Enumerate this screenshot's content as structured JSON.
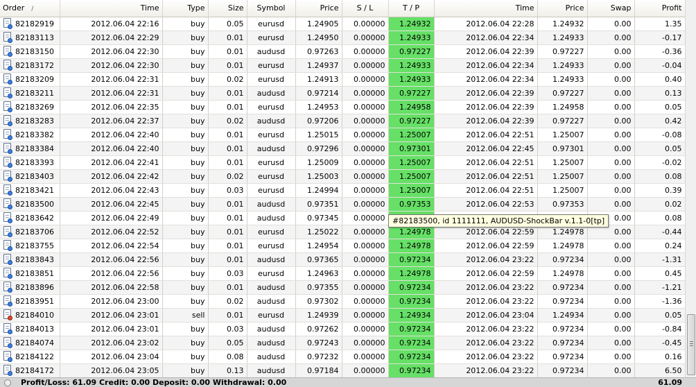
{
  "columns": [
    "Order",
    "Time",
    "Type",
    "Size",
    "Symbol",
    "Price",
    "S / L",
    "T / P",
    "Time",
    "Price",
    "Swap",
    "Profit"
  ],
  "sort_indicator": "/",
  "rows": [
    {
      "order": "82182919",
      "open_time": "2012.06.04 22:16",
      "type": "buy",
      "size": "0.05",
      "symbol": "eurusd",
      "price": "1.24905",
      "sl": "0.00000",
      "tp": "1.24932",
      "close_time": "2012.06.04 22:28",
      "close_price": "1.24932",
      "swap": "0.00",
      "profit": "1.35"
    },
    {
      "order": "82183113",
      "open_time": "2012.06.04 22:29",
      "type": "buy",
      "size": "0.01",
      "symbol": "eurusd",
      "price": "1.24950",
      "sl": "0.00000",
      "tp": "1.24933",
      "close_time": "2012.06.04 22:34",
      "close_price": "1.24933",
      "swap": "0.00",
      "profit": "-0.17"
    },
    {
      "order": "82183150",
      "open_time": "2012.06.04 22:30",
      "type": "buy",
      "size": "0.01",
      "symbol": "audusd",
      "price": "0.97263",
      "sl": "0.00000",
      "tp": "0.97227",
      "close_time": "2012.06.04 22:39",
      "close_price": "0.97227",
      "swap": "0.00",
      "profit": "-0.36"
    },
    {
      "order": "82183172",
      "open_time": "2012.06.04 22:30",
      "type": "buy",
      "size": "0.01",
      "symbol": "eurusd",
      "price": "1.24937",
      "sl": "0.00000",
      "tp": "1.24933",
      "close_time": "2012.06.04 22:34",
      "close_price": "1.24933",
      "swap": "0.00",
      "profit": "-0.04"
    },
    {
      "order": "82183209",
      "open_time": "2012.06.04 22:31",
      "type": "buy",
      "size": "0.02",
      "symbol": "eurusd",
      "price": "1.24913",
      "sl": "0.00000",
      "tp": "1.24933",
      "close_time": "2012.06.04 22:34",
      "close_price": "1.24933",
      "swap": "0.00",
      "profit": "0.40"
    },
    {
      "order": "82183211",
      "open_time": "2012.06.04 22:31",
      "type": "buy",
      "size": "0.01",
      "symbol": "audusd",
      "price": "0.97214",
      "sl": "0.00000",
      "tp": "0.97227",
      "close_time": "2012.06.04 22:39",
      "close_price": "0.97227",
      "swap": "0.00",
      "profit": "0.13"
    },
    {
      "order": "82183269",
      "open_time": "2012.06.04 22:35",
      "type": "buy",
      "size": "0.01",
      "symbol": "eurusd",
      "price": "1.24953",
      "sl": "0.00000",
      "tp": "1.24958",
      "close_time": "2012.06.04 22:39",
      "close_price": "1.24958",
      "swap": "0.00",
      "profit": "0.05"
    },
    {
      "order": "82183283",
      "open_time": "2012.06.04 22:37",
      "type": "buy",
      "size": "0.02",
      "symbol": "audusd",
      "price": "0.97206",
      "sl": "0.00000",
      "tp": "0.97227",
      "close_time": "2012.06.04 22:39",
      "close_price": "0.97227",
      "swap": "0.00",
      "profit": "0.42"
    },
    {
      "order": "82183382",
      "open_time": "2012.06.04 22:40",
      "type": "buy",
      "size": "0.01",
      "symbol": "eurusd",
      "price": "1.25015",
      "sl": "0.00000",
      "tp": "1.25007",
      "close_time": "2012.06.04 22:51",
      "close_price": "1.25007",
      "swap": "0.00",
      "profit": "-0.08"
    },
    {
      "order": "82183384",
      "open_time": "2012.06.04 22:40",
      "type": "buy",
      "size": "0.01",
      "symbol": "audusd",
      "price": "0.97296",
      "sl": "0.00000",
      "tp": "0.97301",
      "close_time": "2012.06.04 22:45",
      "close_price": "0.97301",
      "swap": "0.00",
      "profit": "0.05"
    },
    {
      "order": "82183393",
      "open_time": "2012.06.04 22:41",
      "type": "buy",
      "size": "0.01",
      "symbol": "eurusd",
      "price": "1.25009",
      "sl": "0.00000",
      "tp": "1.25007",
      "close_time": "2012.06.04 22:51",
      "close_price": "1.25007",
      "swap": "0.00",
      "profit": "-0.02"
    },
    {
      "order": "82183403",
      "open_time": "2012.06.04 22:42",
      "type": "buy",
      "size": "0.02",
      "symbol": "eurusd",
      "price": "1.25003",
      "sl": "0.00000",
      "tp": "1.25007",
      "close_time": "2012.06.04 22:51",
      "close_price": "1.25007",
      "swap": "0.00",
      "profit": "0.08"
    },
    {
      "order": "82183421",
      "open_time": "2012.06.04 22:43",
      "type": "buy",
      "size": "0.03",
      "symbol": "eurusd",
      "price": "1.24994",
      "sl": "0.00000",
      "tp": "1.25007",
      "close_time": "2012.06.04 22:51",
      "close_price": "1.25007",
      "swap": "0.00",
      "profit": "0.39"
    },
    {
      "order": "82183500",
      "open_time": "2012.06.04 22:45",
      "type": "buy",
      "size": "0.01",
      "symbol": "audusd",
      "price": "0.97351",
      "sl": "0.00000",
      "tp": "0.97353",
      "close_time": "2012.06.04 22:53",
      "close_price": "0.97353",
      "swap": "0.00",
      "profit": "0.02"
    },
    {
      "order": "82183642",
      "open_time": "2012.06.04 22:49",
      "type": "buy",
      "size": "0.01",
      "symbol": "audusd",
      "price": "0.97345",
      "sl": "0.00000",
      "tp": "",
      "close_time": "",
      "close_price": "",
      "swap": "0.00",
      "profit": "0.08"
    },
    {
      "order": "82183706",
      "open_time": "2012.06.04 22:52",
      "type": "buy",
      "size": "0.01",
      "symbol": "eurusd",
      "price": "1.25022",
      "sl": "0.00000",
      "tp": "1.24978",
      "close_time": "2012.06.04 22:59",
      "close_price": "1.24978",
      "swap": "0.00",
      "profit": "-0.44"
    },
    {
      "order": "82183755",
      "open_time": "2012.06.04 22:54",
      "type": "buy",
      "size": "0.01",
      "symbol": "eurusd",
      "price": "1.24954",
      "sl": "0.00000",
      "tp": "1.24978",
      "close_time": "2012.06.04 22:59",
      "close_price": "1.24978",
      "swap": "0.00",
      "profit": "0.24"
    },
    {
      "order": "82183843",
      "open_time": "2012.06.04 22:56",
      "type": "buy",
      "size": "0.01",
      "symbol": "audusd",
      "price": "0.97365",
      "sl": "0.00000",
      "tp": "0.97234",
      "close_time": "2012.06.04 23:22",
      "close_price": "0.97234",
      "swap": "0.00",
      "profit": "-1.31"
    },
    {
      "order": "82183851",
      "open_time": "2012.06.04 22:56",
      "type": "buy",
      "size": "0.03",
      "symbol": "eurusd",
      "price": "1.24963",
      "sl": "0.00000",
      "tp": "1.24978",
      "close_time": "2012.06.04 22:59",
      "close_price": "1.24978",
      "swap": "0.00",
      "profit": "0.45"
    },
    {
      "order": "82183896",
      "open_time": "2012.06.04 22:58",
      "type": "buy",
      "size": "0.01",
      "symbol": "audusd",
      "price": "0.97355",
      "sl": "0.00000",
      "tp": "0.97234",
      "close_time": "2012.06.04 23:22",
      "close_price": "0.97234",
      "swap": "0.00",
      "profit": "-1.21"
    },
    {
      "order": "82183951",
      "open_time": "2012.06.04 23:00",
      "type": "buy",
      "size": "0.02",
      "symbol": "audusd",
      "price": "0.97302",
      "sl": "0.00000",
      "tp": "0.97234",
      "close_time": "2012.06.04 23:22",
      "close_price": "0.97234",
      "swap": "0.00",
      "profit": "-1.36"
    },
    {
      "order": "82184010",
      "open_time": "2012.06.04 23:01",
      "type": "sell",
      "size": "0.01",
      "symbol": "eurusd",
      "price": "1.24939",
      "sl": "0.00000",
      "tp": "1.24934",
      "close_time": "2012.06.04 23:04",
      "close_price": "1.24934",
      "swap": "0.00",
      "profit": "0.05"
    },
    {
      "order": "82184013",
      "open_time": "2012.06.04 23:01",
      "type": "buy",
      "size": "0.03",
      "symbol": "audusd",
      "price": "0.97262",
      "sl": "0.00000",
      "tp": "0.97234",
      "close_time": "2012.06.04 23:22",
      "close_price": "0.97234",
      "swap": "0.00",
      "profit": "-0.84"
    },
    {
      "order": "82184074",
      "open_time": "2012.06.04 23:02",
      "type": "buy",
      "size": "0.05",
      "symbol": "audusd",
      "price": "0.97243",
      "sl": "0.00000",
      "tp": "0.97234",
      "close_time": "2012.06.04 23:22",
      "close_price": "0.97234",
      "swap": "0.00",
      "profit": "-0.45"
    },
    {
      "order": "82184122",
      "open_time": "2012.06.04 23:04",
      "type": "buy",
      "size": "0.08",
      "symbol": "audusd",
      "price": "0.97232",
      "sl": "0.00000",
      "tp": "0.97234",
      "close_time": "2012.06.04 23:22",
      "close_price": "0.97234",
      "swap": "0.00",
      "profit": "0.16"
    },
    {
      "order": "82184172",
      "open_time": "2012.06.04 23:05",
      "type": "buy",
      "size": "0.13",
      "symbol": "audusd",
      "price": "0.97184",
      "sl": "0.00000",
      "tp": "0.97234",
      "close_time": "2012.06.04 23:22",
      "close_price": "0.97234",
      "swap": "0.00",
      "profit": "6.50"
    }
  ],
  "tooltip": "#82183500, id 1111111, AUDUSD-ShockBar v.1.1-0[tp]",
  "status": {
    "summary": "Profit/Loss: 61.09  Credit: 0.00  Deposit: 0.00  Withdrawal: 0.00",
    "total": "61.09"
  },
  "colors": {
    "tp_highlight": "#66e066",
    "tooltip_bg": "#ffffe1"
  },
  "icons": {
    "buy": "document-buy-icon",
    "sell": "document-sell-icon"
  }
}
